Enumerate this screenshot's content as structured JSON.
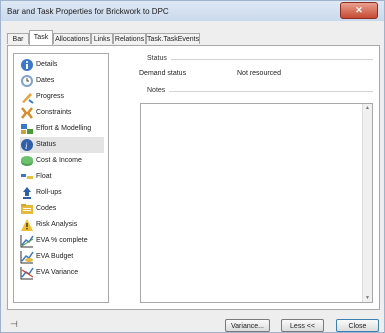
{
  "window": {
    "title": "Bar and Task Properties for Brickwork to DPC",
    "close_glyph": "✕"
  },
  "tabs": [
    {
      "label": "Bar"
    },
    {
      "label": "Task"
    },
    {
      "label": "Allocations"
    },
    {
      "label": "Links"
    },
    {
      "label": "Relations"
    },
    {
      "label": "Task.TaskEvents"
    }
  ],
  "active_tab": "Task",
  "sidebar": {
    "items": [
      {
        "label": "Details",
        "icon": "info-icon"
      },
      {
        "label": "Dates",
        "icon": "calendar-icon"
      },
      {
        "label": "Progress",
        "icon": "progress-icon"
      },
      {
        "label": "Constraints",
        "icon": "constraints-icon"
      },
      {
        "label": "Effort & Modelling",
        "icon": "effort-icon"
      },
      {
        "label": "Status",
        "icon": "status-icon"
      },
      {
        "label": "Cost & Income",
        "icon": "cost-icon"
      },
      {
        "label": "Float",
        "icon": "float-icon"
      },
      {
        "label": "Roll-ups",
        "icon": "rollups-icon"
      },
      {
        "label": "Codes",
        "icon": "codes-icon"
      },
      {
        "label": "Risk Analysis",
        "icon": "warning-icon"
      },
      {
        "label": "EVA % complete",
        "icon": "eva-complete-icon"
      },
      {
        "label": "EVA Budget",
        "icon": "eva-budget-icon"
      },
      {
        "label": "EVA Variance",
        "icon": "eva-variance-icon"
      }
    ],
    "selected": "Status"
  },
  "status_section": {
    "header": "Status",
    "demand_status_label": "Demand status",
    "demand_status_value": "Not resourced",
    "notes_header": "Notes"
  },
  "footer": {
    "pin_glyph": "⊣",
    "variance_button": "Variance...",
    "less_button": "Less <<",
    "close_button": "Close"
  }
}
